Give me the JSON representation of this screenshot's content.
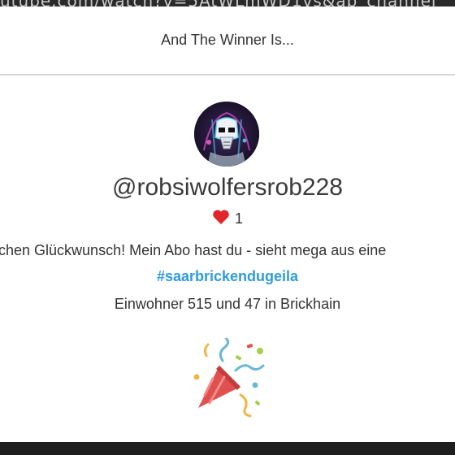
{
  "background": {
    "url_fragment": "utube.com/watch?v=5AtWLmWD1vs&ab_channel"
  },
  "dialog": {
    "title": "And The Winner Is...",
    "winner": {
      "username": "@robsiwolfersrob228",
      "avatar_icon": "stormtrooper-avatar-icon",
      "likes": "1",
      "like_icon": "heart-icon",
      "like_color": "#e0252b",
      "message": "Herzlichen Glückwunsch! Mein Abo hast du - sieht mega aus eine",
      "hashtag": "#saarbrickendugeila",
      "subtext": "Einwohner 515 und 47 in Brickhain"
    },
    "celebration_icon": "party-popper-icon",
    "colors": {
      "hashtag": "#2d9cdb",
      "text": "#333333"
    }
  }
}
